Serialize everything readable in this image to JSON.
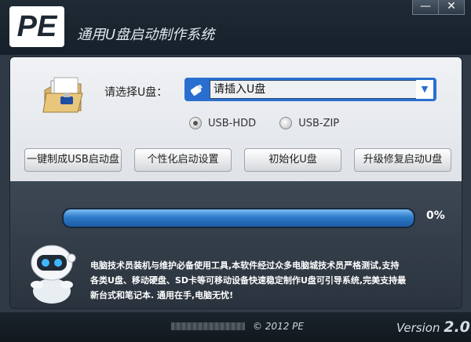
{
  "app": {
    "logo_text": "PE",
    "title": "通用U盘启动制作系统",
    "minimize": "—",
    "close": "✕"
  },
  "select_usb": {
    "label": "请选择U盘：",
    "value": "请插入U盘"
  },
  "mode": {
    "options": [
      "USB-HDD",
      "USB-ZIP"
    ],
    "selected": "USB-HDD"
  },
  "actions": [
    "一键制成USB启动盘",
    "个性化启动设置",
    "初始化U盘",
    "升级修复启动U盘"
  ],
  "progress": {
    "value": 0,
    "text": "0%"
  },
  "description": {
    "line1": "电脑技术员装机与维护必备使用工具,本软件经过众多电脑城技术员严格测试,支持",
    "line2": "各类U盘、移动硬盘、SD卡等可移动设备快速稳定制作U盘可引导系统,完美支持最",
    "line3": "新台式和笔记本. 通用在手,电脑无忧!"
  },
  "footer": {
    "copyright": "© 2012 PE",
    "version_label": "Version",
    "version_number": "2.0"
  },
  "colors": {
    "accent": "#2a6fcf",
    "dark_bg": "#2f3a46"
  },
  "icons": {
    "folder": "folder-usb-icon",
    "usb": "usb-drive-icon",
    "robot": "robot-mascot-icon"
  }
}
